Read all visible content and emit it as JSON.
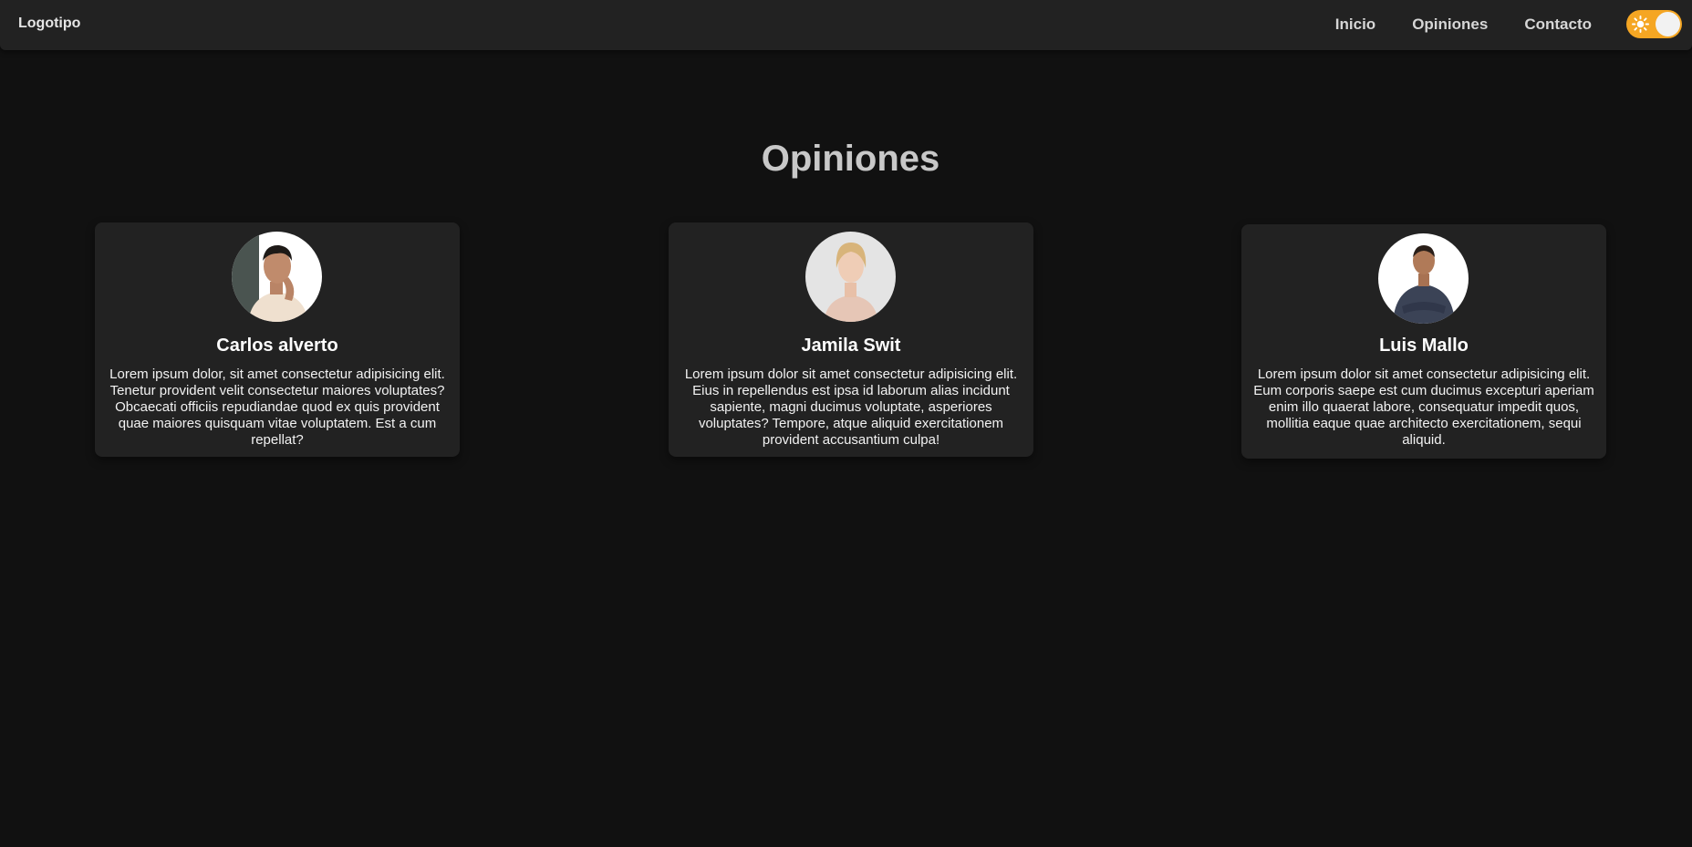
{
  "nav": {
    "logo": "Logotipo",
    "links": [
      "Inicio",
      "Opiniones",
      "Contacto"
    ],
    "theme_toggle_icon": "sun-icon",
    "accent_color": "#f5a623"
  },
  "main": {
    "title": "Opiniones",
    "cards": [
      {
        "name": "Carlos alverto",
        "text": "Lorem ipsum dolor, sit amet consectetur adipisicing elit. Tenetur provident velit consectetur maiores voluptates? Obcaecati officiis repudiandae quod ex quis provident quae maiores quisquam vitae voluptatem. Est a cum repellat?"
      },
      {
        "name": "Jamila Swit",
        "text": "Lorem ipsum dolor sit amet consectetur adipisicing elit. Eius in repellendus est ipsa id laborum alias incidunt sapiente, magni ducimus voluptate, asperiores voluptates? Tempore, atque aliquid exercitationem provident accusantium culpa!"
      },
      {
        "name": "Luis Mallo",
        "text": "Lorem ipsum dolor sit amet consectetur adipisicing elit. Eum corporis saepe est cum ducimus excepturi aperiam enim illo quaerat labore, consequatur impedit quos, mollitia eaque quae architecto exercitationem, sequi aliquid."
      }
    ]
  }
}
